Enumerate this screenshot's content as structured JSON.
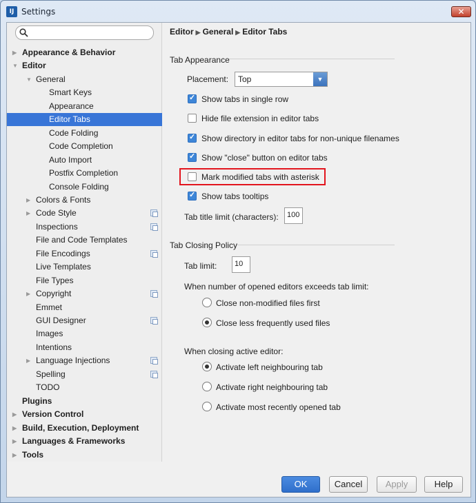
{
  "window": {
    "title": "Settings",
    "icon": "intellij-icon",
    "close_label": "✕"
  },
  "search": {
    "placeholder": ""
  },
  "breadcrumb": {
    "parts": [
      "Editor",
      "General",
      "Editor Tabs"
    ]
  },
  "tree": [
    {
      "label": "Appearance & Behavior",
      "bold": true,
      "level": 0,
      "arrow": "right"
    },
    {
      "label": "Editor",
      "bold": true,
      "level": 0,
      "arrow": "down"
    },
    {
      "label": "General",
      "bold": false,
      "level": 1,
      "arrow": "down"
    },
    {
      "label": "Smart Keys",
      "bold": false,
      "level": 2
    },
    {
      "label": "Appearance",
      "bold": false,
      "level": 2
    },
    {
      "label": "Editor Tabs",
      "bold": false,
      "level": 2,
      "selected": true
    },
    {
      "label": "Code Folding",
      "bold": false,
      "level": 2
    },
    {
      "label": "Code Completion",
      "bold": false,
      "level": 2
    },
    {
      "label": "Auto Import",
      "bold": false,
      "level": 2
    },
    {
      "label": "Postfix Completion",
      "bold": false,
      "level": 2
    },
    {
      "label": "Console Folding",
      "bold": false,
      "level": 2
    },
    {
      "label": "Colors & Fonts",
      "bold": false,
      "level": 1,
      "arrow": "right"
    },
    {
      "label": "Code Style",
      "bold": false,
      "level": 1,
      "arrow": "right",
      "copy": true
    },
    {
      "label": "Inspections",
      "bold": false,
      "level": 1,
      "copy": true
    },
    {
      "label": "File and Code Templates",
      "bold": false,
      "level": 1
    },
    {
      "label": "File Encodings",
      "bold": false,
      "level": 1,
      "copy": true
    },
    {
      "label": "Live Templates",
      "bold": false,
      "level": 1
    },
    {
      "label": "File Types",
      "bold": false,
      "level": 1
    },
    {
      "label": "Copyright",
      "bold": false,
      "level": 1,
      "arrow": "right",
      "copy": true
    },
    {
      "label": "Emmet",
      "bold": false,
      "level": 1
    },
    {
      "label": "GUI Designer",
      "bold": false,
      "level": 1,
      "copy": true
    },
    {
      "label": "Images",
      "bold": false,
      "level": 1
    },
    {
      "label": "Intentions",
      "bold": false,
      "level": 1
    },
    {
      "label": "Language Injections",
      "bold": false,
      "level": 1,
      "arrow": "right",
      "copy": true
    },
    {
      "label": "Spelling",
      "bold": false,
      "level": 1,
      "copy": true
    },
    {
      "label": "TODO",
      "bold": false,
      "level": 1
    },
    {
      "label": "Plugins",
      "bold": true,
      "level": 0
    },
    {
      "label": "Version Control",
      "bold": true,
      "level": 0,
      "arrow": "right"
    },
    {
      "label": "Build, Execution, Deployment",
      "bold": true,
      "level": 0,
      "arrow": "right"
    },
    {
      "label": "Languages & Frameworks",
      "bold": true,
      "level": 0,
      "arrow": "right"
    },
    {
      "label": "Tools",
      "bold": true,
      "level": 0,
      "arrow": "right"
    }
  ],
  "tab_appearance": {
    "title": "Tab Appearance",
    "placement_label": "Placement:",
    "placement_value": "Top",
    "options": [
      {
        "label": "Show tabs in single row",
        "checked": true
      },
      {
        "label": "Hide file extension in editor tabs",
        "checked": false
      },
      {
        "label": "Show directory in editor tabs for non-unique filenames",
        "checked": true
      },
      {
        "label": "Show \"close\" button on editor tabs",
        "checked": true
      },
      {
        "label": "Mark modified tabs with asterisk",
        "checked": false
      },
      {
        "label": "Show tabs tooltips",
        "checked": true
      }
    ],
    "title_limit_label": "Tab title limit (characters):",
    "title_limit_value": "100"
  },
  "tab_closing": {
    "title": "Tab Closing Policy",
    "tab_limit_label": "Tab limit:",
    "tab_limit_value": "10",
    "exceed_label": "When number of opened editors exceeds tab limit:",
    "exceed_options": [
      {
        "label": "Close non-modified files first",
        "selected": false
      },
      {
        "label": "Close less frequently used files",
        "selected": true
      }
    ],
    "active_label": "When closing active editor:",
    "active_options": [
      {
        "label": "Activate left neighbouring tab",
        "selected": true
      },
      {
        "label": "Activate right neighbouring tab",
        "selected": false
      },
      {
        "label": "Activate most recently opened tab",
        "selected": false
      }
    ]
  },
  "buttons": {
    "ok": "OK",
    "cancel": "Cancel",
    "apply": "Apply",
    "help": "Help"
  },
  "colors": {
    "selection": "#3875d7",
    "primary": "#2f6fcb",
    "highlight_border": "#e2141d"
  }
}
